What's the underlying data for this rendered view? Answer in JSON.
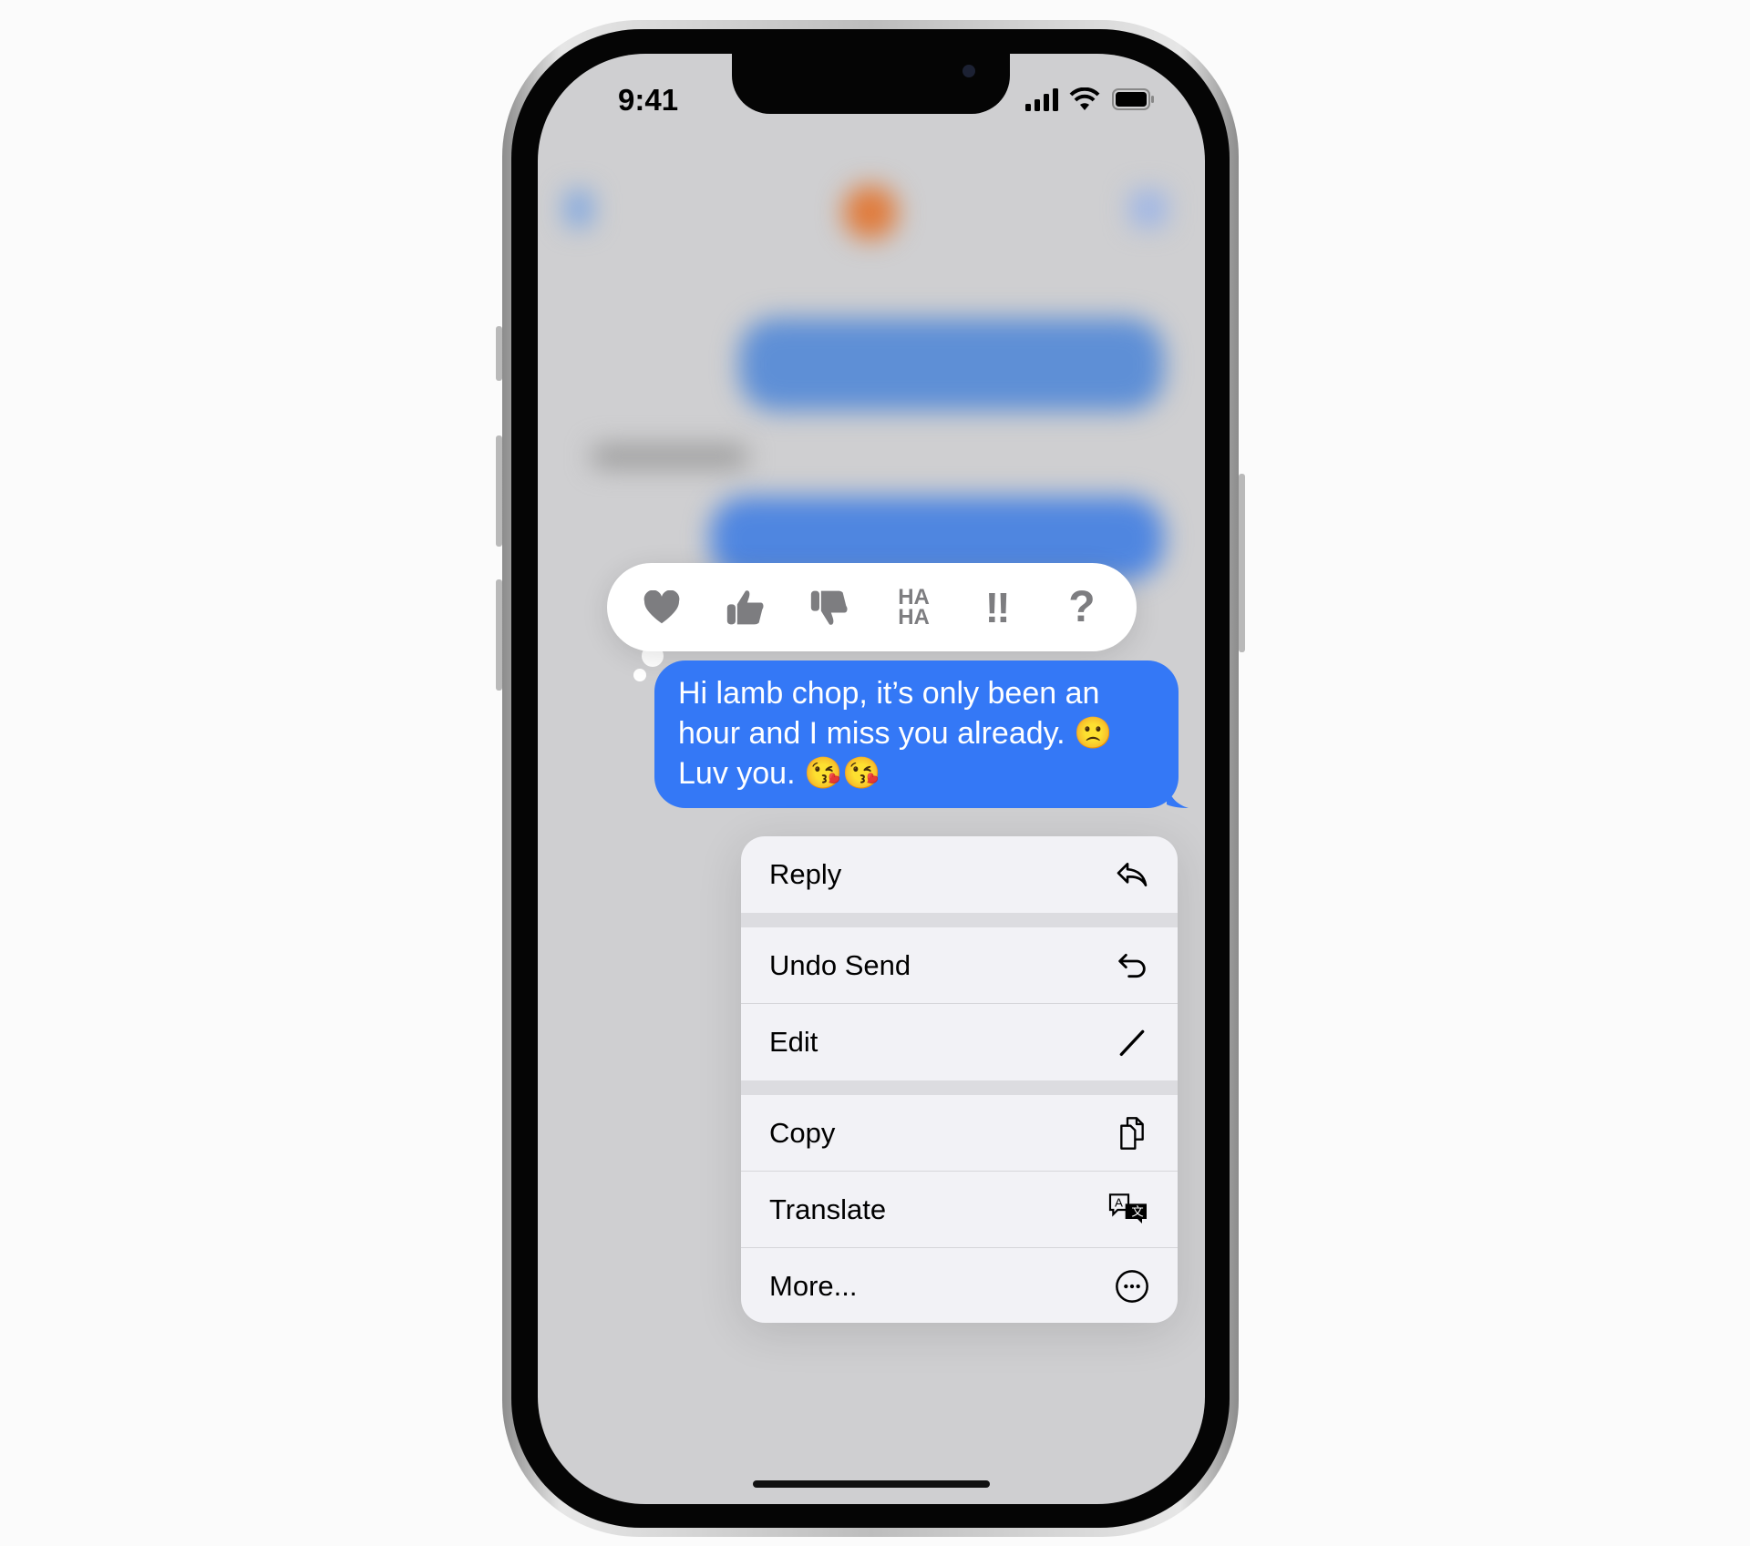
{
  "status_bar": {
    "time": "9:41",
    "icons": [
      "cellular-signal-icon",
      "wifi-icon",
      "battery-icon"
    ]
  },
  "reactions": [
    {
      "name": "heart",
      "icon": "heart-icon"
    },
    {
      "name": "thumbs-up",
      "icon": "thumbs-up-icon"
    },
    {
      "name": "thumbs-down",
      "icon": "thumbs-down-icon"
    },
    {
      "name": "haha",
      "label_top": "HA",
      "label_bottom": "HA"
    },
    {
      "name": "emphasize",
      "label": "‼"
    },
    {
      "name": "question",
      "label": "?"
    }
  ],
  "message": {
    "lines": [
      "Hi lamb chop, it’s only been an",
      "hour and I miss you already. 🙁",
      "Luv you. 😘😘"
    ],
    "color": "#3478f6"
  },
  "menu": {
    "items": [
      {
        "label": "Reply",
        "icon": "reply-icon"
      },
      {
        "label": "Undo Send",
        "icon": "undo-icon"
      },
      {
        "label": "Edit",
        "icon": "pencil-icon"
      },
      {
        "label": "Copy",
        "icon": "copy-icon"
      },
      {
        "label": "Translate",
        "icon": "translate-icon"
      },
      {
        "label": "More...",
        "icon": "ellipsis-circle-icon"
      }
    ]
  }
}
